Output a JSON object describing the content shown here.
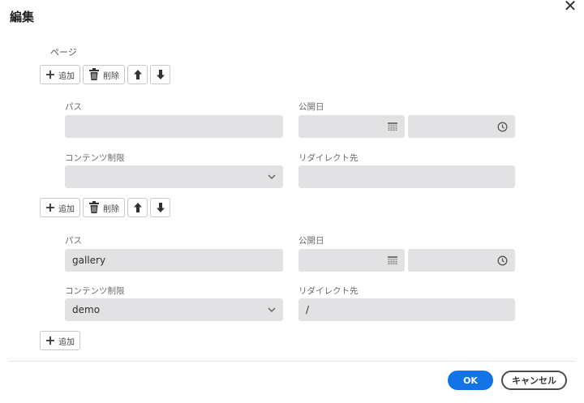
{
  "dialog": {
    "title": "編集",
    "close_glyph": "✕"
  },
  "section": {
    "label": "ページ"
  },
  "toolbar": {
    "add_label": "追加",
    "delete_label": "削除"
  },
  "labels": {
    "path": "パス",
    "publish_date": "公開日",
    "content_restriction": "コンテンツ制限",
    "redirect": "リダイレクト先"
  },
  "items": [
    {
      "path": "",
      "date": "",
      "time": "",
      "restriction": "",
      "redirect": ""
    },
    {
      "path": "gallery",
      "date": "",
      "time": "",
      "restriction": "demo",
      "redirect": "/"
    }
  ],
  "footer": {
    "ok_label": "OK",
    "cancel_label": "キャンセル"
  },
  "colors": {
    "accent": "#1473e6",
    "field_bg": "#e2e2e4"
  },
  "icons": [
    "plus-icon",
    "trash-icon",
    "arrow-up-icon",
    "arrow-down-icon",
    "calendar-icon",
    "clock-icon",
    "chevron-down-icon",
    "close-icon"
  ]
}
